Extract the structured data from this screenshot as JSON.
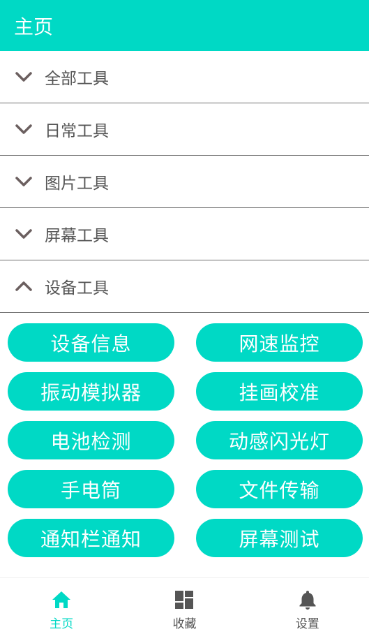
{
  "header": {
    "title": "主页"
  },
  "sections": [
    {
      "label": "全部工具",
      "expanded": false
    },
    {
      "label": "日常工具",
      "expanded": false
    },
    {
      "label": "图片工具",
      "expanded": false
    },
    {
      "label": "屏幕工具",
      "expanded": false
    },
    {
      "label": "设备工具",
      "expanded": true
    }
  ],
  "tools": [
    "设备信息",
    "网速监控",
    "振动模拟器",
    "挂画校准",
    "电池检测",
    "动感闪光灯",
    "手电筒",
    "文件传输",
    "通知栏通知",
    "屏幕测试"
  ],
  "nav": [
    {
      "label": "主页",
      "icon": "home-icon",
      "active": true
    },
    {
      "label": "收藏",
      "icon": "dashboard-icon",
      "active": false
    },
    {
      "label": "设置",
      "icon": "bell-icon",
      "active": false
    }
  ],
  "colors": {
    "accent": "#00d9c5",
    "text": "#555555",
    "icon": "#6b5f5f"
  }
}
